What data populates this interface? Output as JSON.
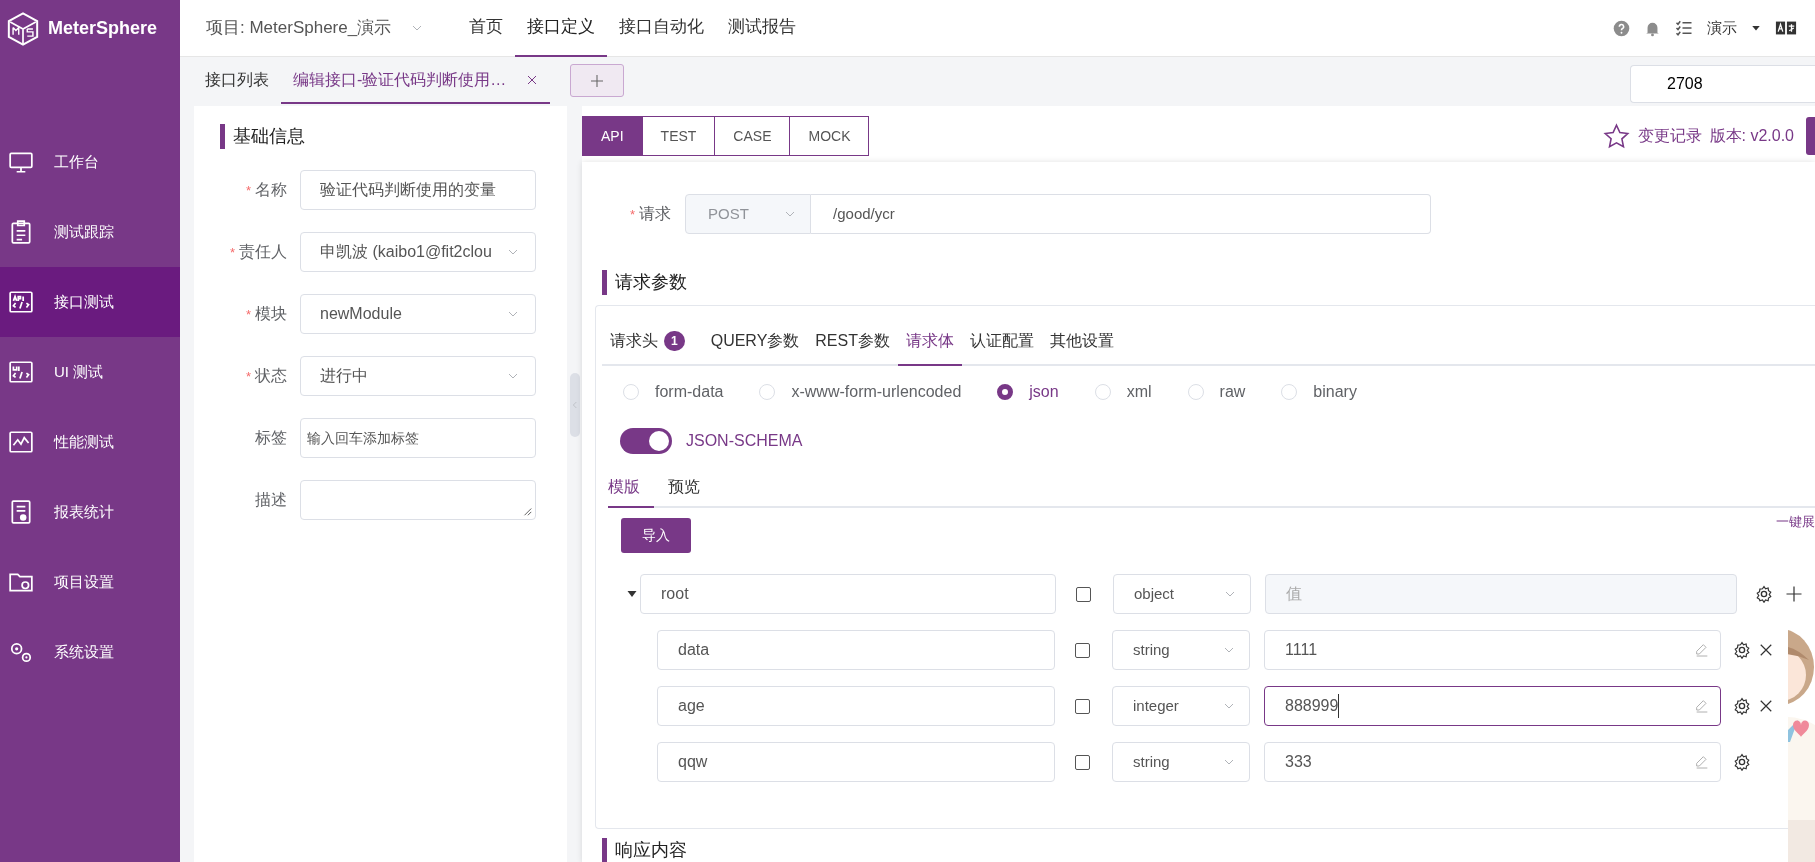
{
  "app": {
    "name": "MeterSphere"
  },
  "sidebar": {
    "items": [
      {
        "label": "工作台",
        "selected": false
      },
      {
        "label": "测试跟踪",
        "selected": false
      },
      {
        "label": "接口测试",
        "selected": true
      },
      {
        "label": "UI 测试",
        "selected": false
      },
      {
        "label": "性能测试",
        "selected": false
      },
      {
        "label": "报表统计",
        "selected": false
      },
      {
        "label": "项目设置",
        "selected": false
      },
      {
        "label": "系统设置",
        "selected": false
      }
    ]
  },
  "top_nav": {
    "project": "项目: MeterSphere_演示",
    "items": [
      {
        "label": "首页",
        "selected": false
      },
      {
        "label": "接口定义",
        "selected": true
      },
      {
        "label": "接口自动化",
        "selected": false
      },
      {
        "label": "测试报告",
        "selected": false
      }
    ],
    "user": "演示"
  },
  "doc_tabs": [
    {
      "label": "接口列表",
      "selected": false,
      "closable": false
    },
    {
      "label": "编辑接口-验证代码判断使用…",
      "selected": true,
      "closable": true
    }
  ],
  "search": {
    "value": "2708"
  },
  "basic_info": {
    "title": "基础信息",
    "fields": [
      {
        "label": "名称",
        "required_mark": "*",
        "kind": "input",
        "value": "验证代码判断使用的变量"
      },
      {
        "label": "责任人",
        "required_mark": "*",
        "kind": "select",
        "value": "申凯波 (kaibo1@fit2clou"
      },
      {
        "label": "模块",
        "required_mark": "*",
        "kind": "select",
        "value": "newModule"
      },
      {
        "label": "状态",
        "required_mark": "*",
        "kind": "select",
        "value": "进行中"
      },
      {
        "label": "标签",
        "kind": "input",
        "placeholder": "输入回车添加标签"
      },
      {
        "label": "描述",
        "kind": "textarea"
      }
    ]
  },
  "mode_tabs": [
    {
      "label": "API",
      "selected": true
    },
    {
      "label": "TEST",
      "selected": false
    },
    {
      "label": "CASE",
      "selected": false
    },
    {
      "label": "MOCK",
      "selected": false
    }
  ],
  "version": {
    "history": "变更记录",
    "version": "版本: v2.0.0"
  },
  "request": {
    "label": "请求",
    "required_mark": "*",
    "method": "POST",
    "url": "/good/ycr"
  },
  "params": {
    "title": "请求参数",
    "tabs": [
      {
        "label": "请求头",
        "badge": "1",
        "selected": false
      },
      {
        "label": "QUERY参数",
        "selected": false
      },
      {
        "label": "REST参数",
        "selected": false
      },
      {
        "label": "请求体",
        "selected": true
      },
      {
        "label": "认证配置",
        "selected": false
      },
      {
        "label": "其他设置",
        "selected": false
      }
    ],
    "body_types": [
      {
        "label": "form-data",
        "selected": false
      },
      {
        "label": "x-www-form-urlencoded",
        "selected": false
      },
      {
        "label": "json",
        "selected": true
      },
      {
        "label": "xml",
        "selected": false
      },
      {
        "label": "raw",
        "selected": false
      },
      {
        "label": "binary",
        "selected": false
      }
    ],
    "json_schema": {
      "label": "JSON-SCHEMA",
      "on": true
    },
    "view_tabs": [
      {
        "label": "模版",
        "selected": true
      },
      {
        "label": "预览",
        "selected": false
      }
    ],
    "import_button": "导入",
    "expand_link": "一键展",
    "rows": [
      {
        "name": "root",
        "checked": false,
        "type": "object",
        "placeholder": "值",
        "disabled": true,
        "expanded": true,
        "children": [
          {
            "name": "data",
            "checked": false,
            "type": "string",
            "value": "1111",
            "focused": false
          },
          {
            "name": "age",
            "checked": false,
            "type": "integer",
            "value": "888999",
            "focused": true
          },
          {
            "name": "qqw",
            "checked": false,
            "type": "string",
            "value": "333",
            "focused": false
          }
        ]
      }
    ]
  },
  "response": {
    "title": "响应内容"
  }
}
